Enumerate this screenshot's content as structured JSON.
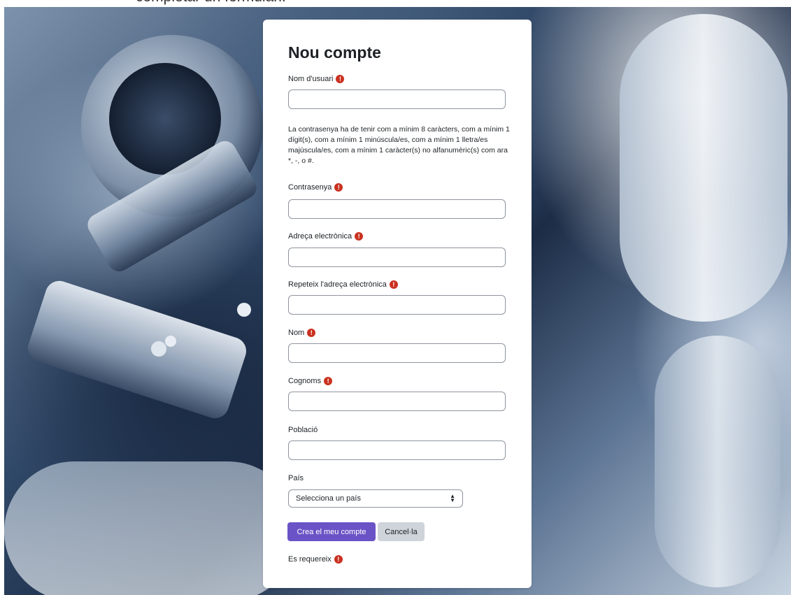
{
  "page": {
    "caption_partial": "completar un formulari."
  },
  "form": {
    "title": "Nou compte",
    "fields": [
      {
        "label": "Nom d'usuari",
        "required": true,
        "value": ""
      },
      {
        "label": "Contrasenya",
        "required": true,
        "value": ""
      },
      {
        "label": "Adreça electrònica",
        "required": true,
        "value": ""
      },
      {
        "label": "Repeteix l'adreça electrònica",
        "required": true,
        "value": ""
      },
      {
        "label": "Nom",
        "required": true,
        "value": ""
      },
      {
        "label": "Cognoms",
        "required": true,
        "value": ""
      },
      {
        "label": "Població",
        "required": false,
        "value": ""
      }
    ],
    "password_rules": "La contrasenya ha de tenir com a mínim 8 caràcters, com a mínim 1 dígit(s), com a mínim 1 minúscula/es, com a mínim 1 lletra/es majúscula/es, com a mínim 1 caràcter(s) no alfanumèric(s) com ara *, -, o #.",
    "country": {
      "label": "País",
      "selected": "Selecciona un país"
    },
    "buttons": {
      "submit": "Crea el meu compte",
      "cancel": "Cancel·la"
    },
    "required_note": "Es requereix",
    "required_icon": "!",
    "colors": {
      "primary_button": "#6a53c6",
      "secondary_button": "#ced4da",
      "required_icon": "#ca3120"
    }
  }
}
